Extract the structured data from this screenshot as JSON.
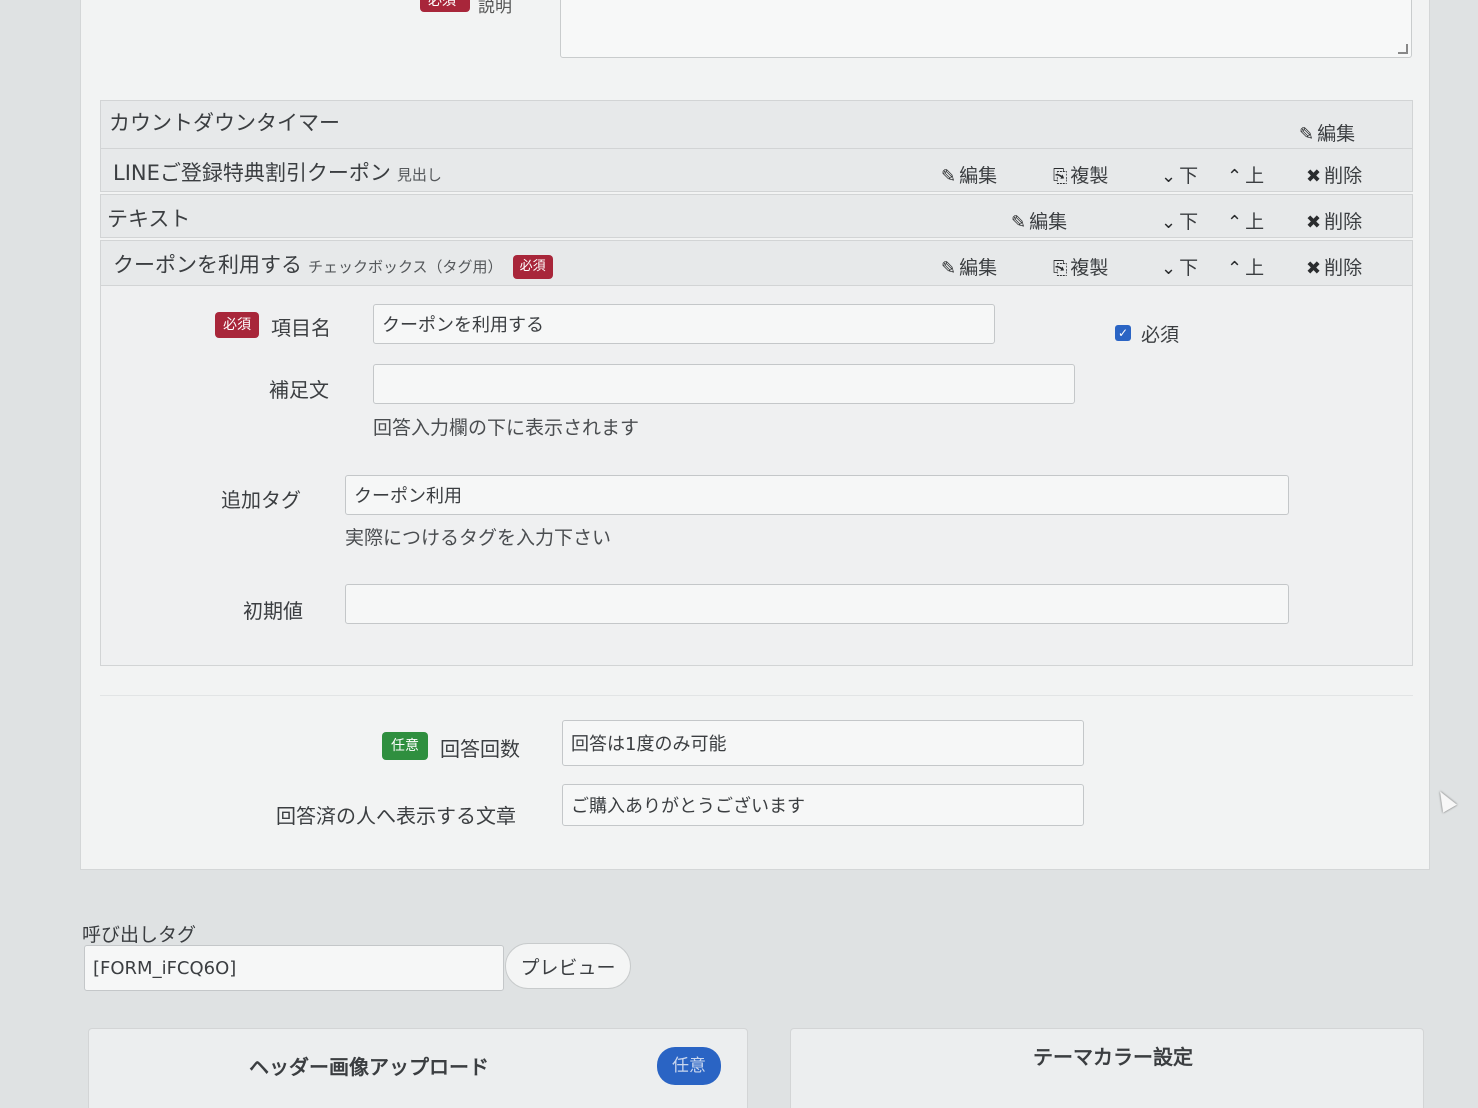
{
  "top": {
    "badge": "必須",
    "label": "説明"
  },
  "rows": [
    {
      "title": "カウントダウンタイマー",
      "subtitle": "",
      "actions": {
        "edit": "編集"
      }
    },
    {
      "title": "LINEご登録特典割引クーポン",
      "subtitle": "見出し",
      "actions": {
        "edit": "編集",
        "copy": "複製",
        "down": "下",
        "up": "上",
        "delete": "削除"
      }
    },
    {
      "title": "テキスト",
      "subtitle": "",
      "actions": {
        "edit": "編集",
        "down": "下",
        "up": "上",
        "delete": "削除"
      }
    },
    {
      "title": "クーポンを利用する",
      "subtitle": "チェックボックス（タグ用）",
      "badge": "必須",
      "actions": {
        "edit": "編集",
        "copy": "複製",
        "down": "下",
        "up": "上",
        "delete": "削除"
      }
    }
  ],
  "editor": {
    "item_name": {
      "badge": "必須",
      "label": "項目名",
      "value": "クーポンを利用する"
    },
    "required_checkbox": {
      "label": "必須",
      "checked": true
    },
    "supplement": {
      "label": "補足文",
      "value": "",
      "help": "回答入力欄の下に表示されます"
    },
    "add_tag": {
      "label": "追加タグ",
      "value": "クーポン利用",
      "help": "実際につけるタグを入力下さい"
    },
    "initial_value": {
      "label": "初期値",
      "value": ""
    }
  },
  "answer": {
    "count": {
      "badge": "任意",
      "label": "回答回数",
      "value": "回答は1度のみ可能"
    },
    "message": {
      "label": "回答済の人へ表示する文章",
      "value": "ご購入ありがとうございます"
    }
  },
  "call_tag": {
    "label": "呼び出しタグ",
    "value": "[FORM_iFCQ6O]",
    "preview": "プレビュー"
  },
  "cards": {
    "header_upload": {
      "title": "ヘッダー画像アップロード",
      "badge": "任意"
    },
    "theme_color": {
      "title": "テーマカラー設定"
    }
  },
  "colors": {
    "required": "#a8263a",
    "optional": "#2f8f3f",
    "accent": "#2a64c4"
  }
}
